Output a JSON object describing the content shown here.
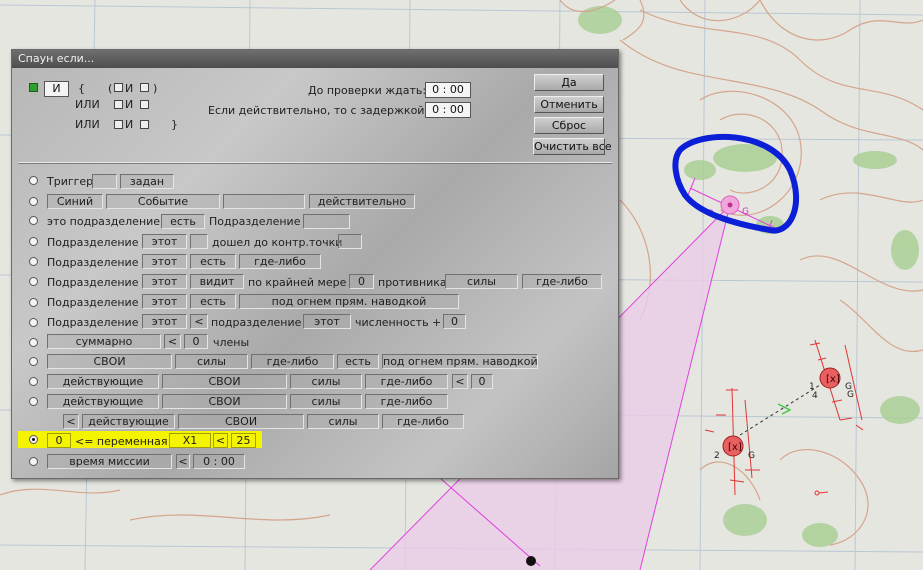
{
  "dialog": {
    "title": "Спаун если...",
    "logic": {
      "and1": "И",
      "brace_open": "{",
      "paren_open": "(",
      "and_a": "И",
      "paren_close": ")",
      "or1": "ИЛИ",
      "and_b": "И",
      "or2": "ИЛИ",
      "and_c": "И",
      "brace_close": "}"
    },
    "wait_label": "До проверки ждать:",
    "wait_value": "0 : 00",
    "delay_label": "Если действительно, то с задержкой:",
    "delay_value": "0 : 00",
    "buttons": {
      "ok": "Да",
      "cancel": "Отменить",
      "reset": "Сброс",
      "clear_all": "Очистить все"
    }
  },
  "conditions": {
    "r1": {
      "a": "Триггер",
      "b": "задан"
    },
    "r2": {
      "a": "Синий",
      "b": "Событие",
      "c": "действительно"
    },
    "r3": {
      "a": "это подразделение",
      "b": "есть",
      "c": "Подразделение"
    },
    "r4": {
      "a": "Подразделение",
      "b": "этот",
      "c": "дошел до контр.точки"
    },
    "r5": {
      "a": "Подразделение",
      "b": "этот",
      "c": "есть",
      "d": "где-либо"
    },
    "r6": {
      "a": "Подразделение",
      "b": "этот",
      "c": "видит",
      "d": "по крайней мере",
      "e": "0",
      "f": "противника",
      "g": "силы",
      "h": "где-либо"
    },
    "r7": {
      "a": "Подразделение",
      "b": "этот",
      "c": "есть",
      "d": "под огнем прям. наводкой"
    },
    "r8": {
      "a": "Подразделение",
      "b": "этот",
      "c": "<",
      "d": "подразделение",
      "e": "этот",
      "f": "численность +",
      "g": "0"
    },
    "r9": {
      "a": "суммарно",
      "b": "<",
      "c": "0",
      "d": "члены"
    },
    "r10": {
      "a": "СВОИ",
      "b": "силы",
      "c": "где-либо",
      "d": "есть",
      "e": "под огнем прям. наводкой"
    },
    "r11": {
      "a": "действующие",
      "b": "СВОИ",
      "c": "силы",
      "d": "где-либо",
      "e": "<",
      "f": "0"
    },
    "r12": {
      "a": "действующие",
      "b": "СВОИ",
      "c": "силы",
      "d": "где-либо"
    },
    "r13": {
      "a": "<",
      "b": "действующие",
      "c": "СВОИ",
      "d": "силы",
      "e": "где-либо"
    },
    "r14": {
      "a": "0",
      "b": "<= переменная",
      "c": "X1",
      "d": "<",
      "e": "25"
    },
    "r15": {
      "a": "время миссии",
      "b": "<",
      "c": "0 : 00"
    }
  },
  "map": {
    "units": [
      {
        "id": "3",
        "flag": "G"
      },
      {
        "id": "4",
        "flag": "G"
      },
      {
        "id": "1",
        "flag": "G"
      },
      {
        "id": "2",
        "flag": "G"
      }
    ],
    "colors": {
      "highlight": "#f4f400",
      "circle": "#0b1fd6",
      "unit_red": "#e03535",
      "route": "#e040e0"
    }
  }
}
